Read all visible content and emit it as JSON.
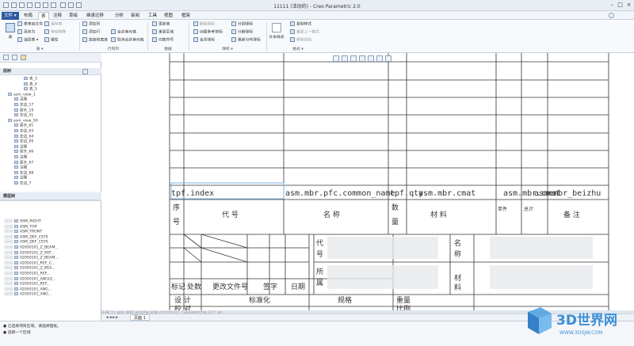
{
  "window": {
    "title": "11111 (活动的) - Creo Parametric 2.0",
    "buttons": [
      "–",
      "□",
      "×"
    ]
  },
  "menu": {
    "tabs": [
      "文件 ▾",
      "布局",
      "表",
      "注释",
      "草绘",
      "继承迁移",
      "分析",
      "审阅",
      "工具",
      "视图",
      "框架"
    ],
    "active_index": 2
  },
  "ribbon": {
    "groups": {
      "table_label": "表 ▾",
      "rows_cols_label": "行和列",
      "data_label": "数据",
      "balloon_label": "球标 ▾",
      "format_label": "格式 ▾"
    },
    "table": {
      "big_button": "表",
      "items": [
        "表来自文件",
        "另存为",
        "表来自文件",
        "保存表",
        "移动特殊",
        "属性",
        "选择表 ▾"
      ]
    },
    "rows_cols": [
      "添加列",
      "添加行",
      "高度和宽度",
      "合并单元格",
      "取消合并单元格",
      "取消合并单元格"
    ],
    "data": [
      "更新表",
      "重复区域",
      "切换符号"
    ],
    "balloon": [
      "删除球标",
      "分割球标",
      "创建参考球标",
      "分解球标",
      "合并球标",
      "重新分布球标"
    ],
    "format": [
      "复制样式",
      "重复上一格式",
      "移除线段"
    ],
    "format_buttons": [
      "文本样式"
    ]
  },
  "left_panel": {
    "layer_tree_title": "层树",
    "tree_items": [
      "表_3",
      "表_4",
      "表_5",
      "asm_view_1",
      "注释",
      "左边_17",
      "箭头_19",
      "左边_41",
      "asm_view_50",
      "箭头_61",
      "左边_63",
      "左边_64",
      "左边_65",
      "注释",
      "箭头_66",
      "注释",
      "箭头_67",
      "注释",
      "左边_68",
      "注释",
      "左边_7"
    ],
    "model_tree_title": "模型树",
    "model_items": [
      "ASM_RIGHT",
      "ASM_TOP",
      "ASM_FRONT",
      "ASM_DEF_CSYS",
      "ASM_DEF_CSYS",
      "02050101_Z_BEAM...",
      "02050101_Z_REF...",
      "02050101_Z_BEAM...",
      "02050101_REF_C...",
      "02050101_Z_BEA...",
      "02050101_REF...",
      "02050101_ANGLE...",
      "02050101_REF...",
      "02050101_ANG...",
      "02050101_ANG..."
    ]
  },
  "drawing": {
    "top_rows_labels": {
      "col1": "tpf.index",
      "col2": "asm.mbr.pfc.common_name",
      "col3": "tpf.qty",
      "col4": "asm.mbr.cmat",
      "col5": "asm.mbr.cmat",
      "col6": "asmembr_beizhu"
    },
    "header_row": {
      "seq": "序\n号",
      "code": "代 号",
      "name": "名    称",
      "qty": "数\n量",
      "material": "材    料",
      "single": "单件",
      "total": "总计",
      "remarks": "备 注"
    },
    "title_block": {
      "code_label": "代\n号",
      "owner_label": "所\n属",
      "name_label": "名\n称",
      "material_label": "材\n料",
      "mark": "标记",
      "count": "处数",
      "change_doc": "更改文件号",
      "sign": "签字",
      "date": "日期",
      "design": "设 计",
      "standard": "标准化",
      "spec": "规格",
      "weight": "重量",
      "check": "校 对",
      "ratio": "比例"
    }
  },
  "status": {
    "info": "比例:21:400    类型:ASSEM    名称:02050101_QIANPINGTAI    尺寸:A0",
    "sheet_tab": "页面 1",
    "messages": [
      "● 已选择项目区域。请选择图纸。",
      "● 选择一个区域"
    ]
  },
  "watermark": {
    "text": "3D世界网",
    "url": "WWW.3DSJW.COM"
  }
}
